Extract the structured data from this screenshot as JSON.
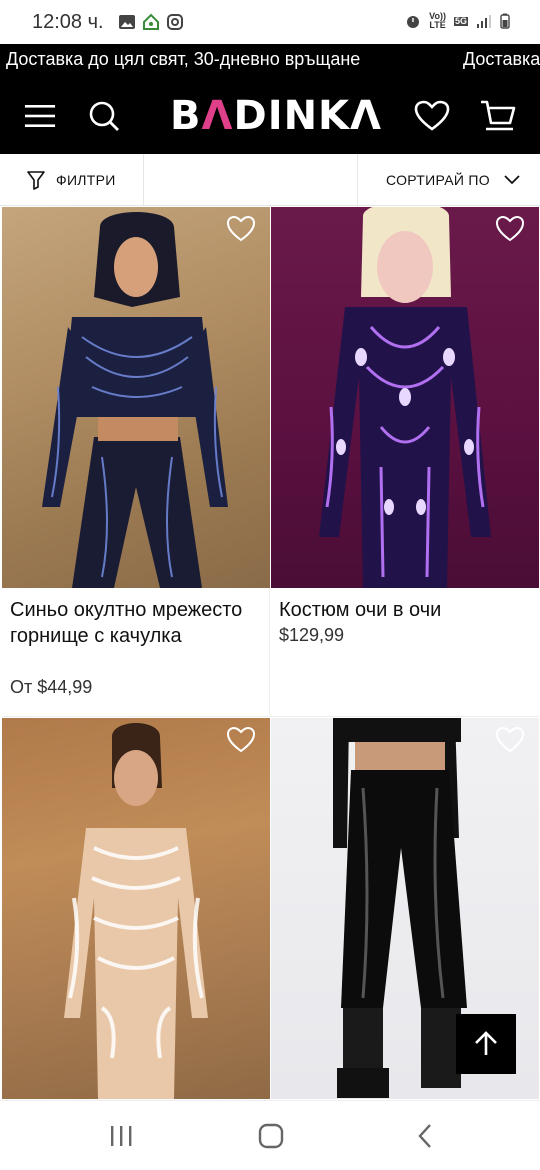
{
  "status_bar": {
    "time": "12:08 ч.",
    "volte": "Vo))",
    "lte": "LTE",
    "fiveg": "5G"
  },
  "announcement": {
    "text": "Доставка до цял свят, 30-дневно връщане",
    "text_repeat": "Доставка"
  },
  "header": {
    "logo_text_a": "B",
    "logo_text_b": "Λ",
    "logo_text_c": "DINKΛ",
    "icons": [
      "menu-icon",
      "search-icon",
      "heart-icon",
      "cart-icon"
    ]
  },
  "filter_bar": {
    "filter_label": "ФИЛТРИ",
    "sort_label": "СОРТИРАЙ ПО"
  },
  "products": [
    {
      "name": "Синьо окултно мрежесто горнище с качулка",
      "price": "От $44,99"
    },
    {
      "name": "Костюм очи в очи",
      "price": "$129,99"
    },
    {
      "name": "",
      "price": ""
    },
    {
      "name": "",
      "price": ""
    }
  ],
  "colors": {
    "accent": "#e0408a",
    "header_bg": "#000000"
  }
}
